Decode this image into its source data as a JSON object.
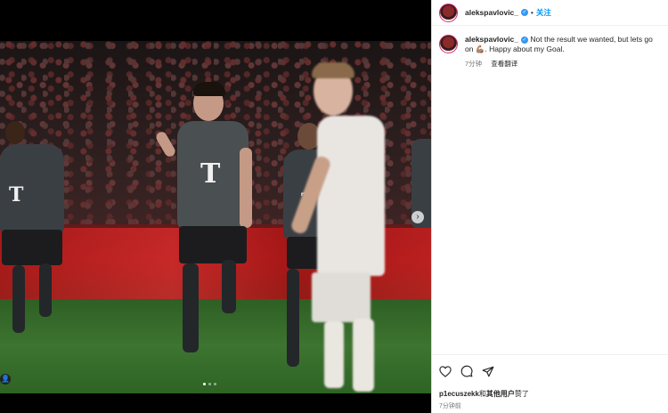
{
  "post": {
    "username": "alekspavlovic_",
    "follow_label": "关注",
    "separator": "•",
    "caption": "Not the result we wanted, but lets go on 💪🏽. Happy about my Goal.",
    "comment_time": "7分钟",
    "translate_label": "查看翻译",
    "likes_user": "p1ecuszekk",
    "likes_connector": "和",
    "likes_others": "其他用户",
    "likes_suffix": "赞了",
    "post_time": "7分钟前"
  },
  "media": {
    "carousel_dots": 3,
    "active_dot": 0,
    "next_glyph": "›",
    "tag_glyph": "👤"
  },
  "icons": {
    "like": "heart-icon",
    "comment": "comment-icon",
    "share": "share-icon",
    "verified": "verified-badge-icon"
  },
  "colors": {
    "follow": "#0095f6",
    "verified": "#3897f0",
    "text": "#262626",
    "muted": "#737373"
  }
}
